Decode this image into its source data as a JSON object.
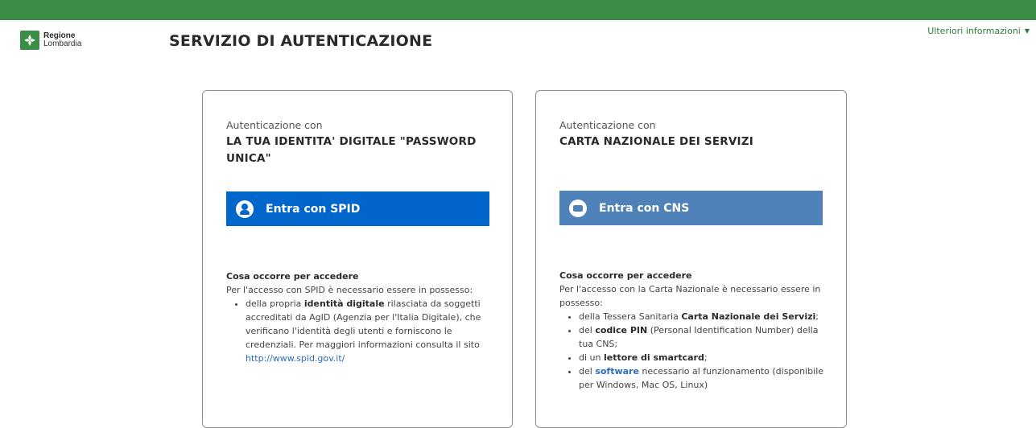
{
  "header": {
    "logo": {
      "line1": "Regione",
      "line2": "Lombardia"
    },
    "title": "SERVIZIO DI AUTENTICAZIONE",
    "more_info": "Ulteriori informazioni"
  },
  "colors": {
    "brand_green": "#3c8d46",
    "spid_blue": "#0066cc",
    "cns_blue": "#4f82b8"
  },
  "spid_card": {
    "auth_with": "Autenticazione con",
    "title": "LA TUA IDENTITA' DIGITALE \"PASSWORD UNICA\"",
    "button_label": "Entra con SPID",
    "button_icon": "user-icon",
    "req_heading": "Cosa occorre per accedere",
    "req_intro": "Per l'accesso con SPID è necessario essere in possesso:",
    "item1_pre": "della propria ",
    "item1_bold": "identità digitale",
    "item1_post": " rilasciata da soggetti accreditati da AgID (Agenzia per l'Italia Digitale), che verificano l'identità degli utenti e forniscono le credenziali. Per maggiori informazioni consulta il sito ",
    "item1_link": "http://www.spid.gov.it/"
  },
  "cns_card": {
    "auth_with": "Autenticazione con",
    "title": "CARTA NAZIONALE DEI SERVIZI",
    "button_label": "Entra con CNS",
    "button_icon": "card-icon",
    "req_heading": "Cosa occorre per accedere",
    "req_intro": "Per l'accesso con la Carta Nazionale è necessario essere in possesso:",
    "items": [
      {
        "pre": "della Tessera Sanitaria ",
        "bold": "Carta Nazionale dei Servizi",
        "post": ";"
      },
      {
        "pre": "del ",
        "bold": "codice PIN",
        "post": " (Personal Identification Number) della tua CNS;"
      },
      {
        "pre": "di un ",
        "bold": "lettore di smartcard",
        "post": ";"
      },
      {
        "pre": "del ",
        "bold": "software",
        "post": " necessario al funzionamento (disponibile per Windows, Mac OS, Linux)"
      }
    ]
  }
}
